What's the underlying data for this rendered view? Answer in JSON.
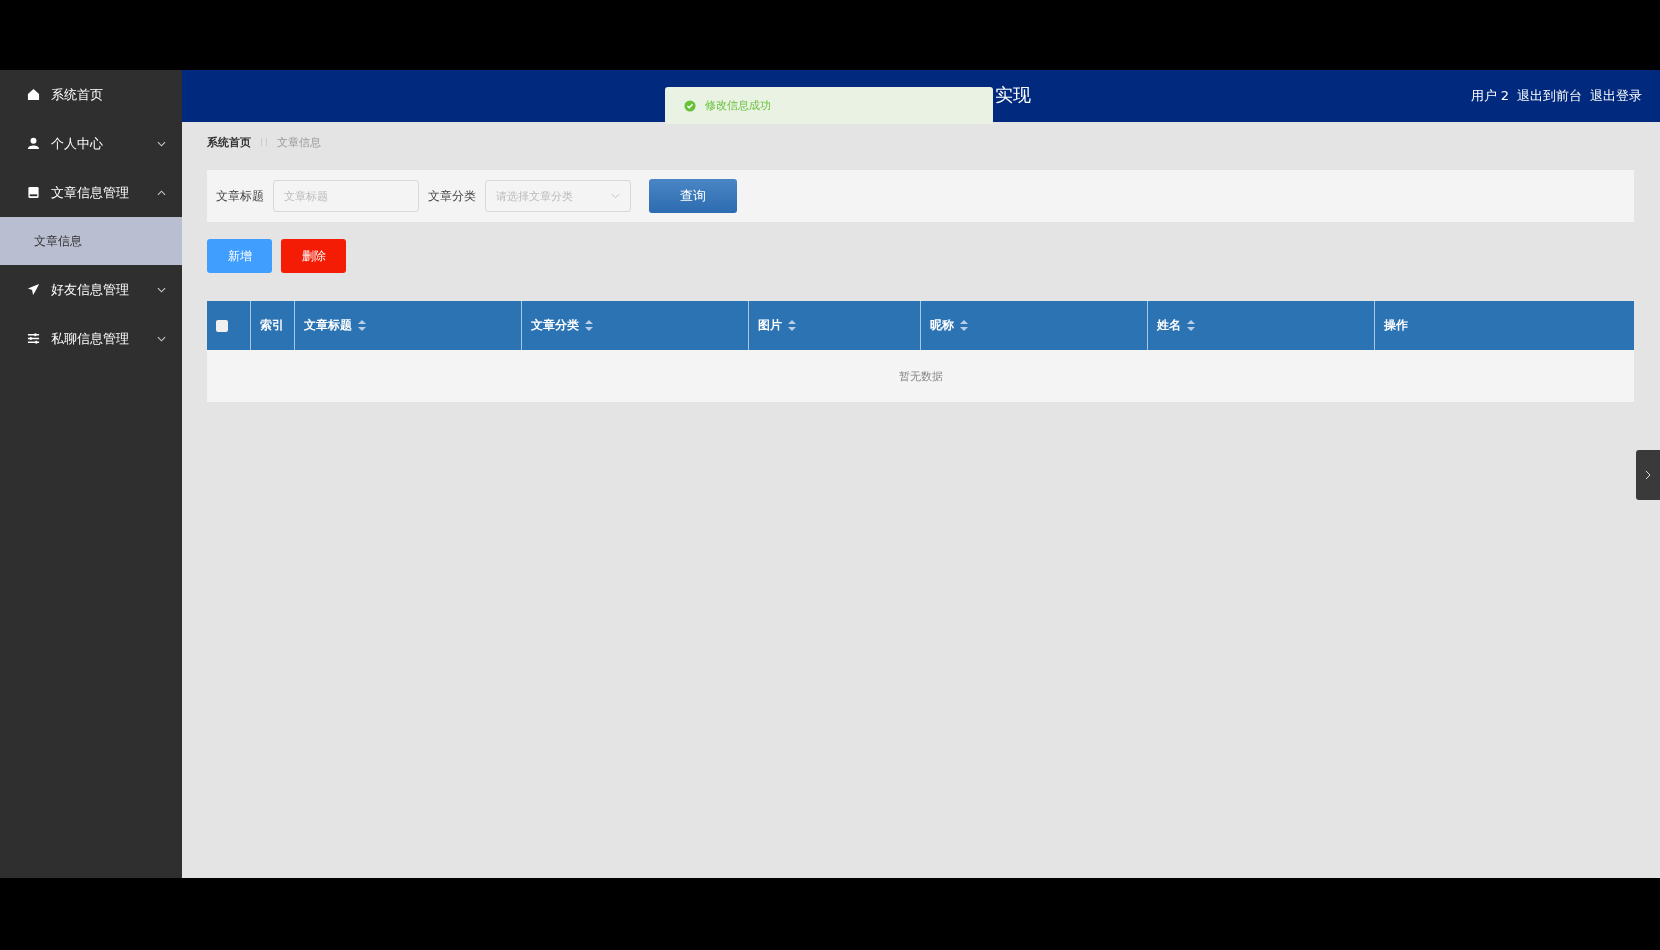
{
  "sidebar": {
    "items": [
      {
        "label": "系统首页",
        "kind": "home"
      },
      {
        "label": "个人中心",
        "kind": "user",
        "expanded": false
      },
      {
        "label": "文章信息管理",
        "kind": "document",
        "expanded": true,
        "children": [
          {
            "label": "文章信息",
            "selected": true
          }
        ]
      },
      {
        "label": "好友信息管理",
        "kind": "plane",
        "expanded": false
      },
      {
        "label": "私聊信息管理",
        "kind": "sliders",
        "expanded": false
      }
    ]
  },
  "header": {
    "title": "实现",
    "user": "用户 2",
    "links": [
      "退出到前台",
      "退出登录"
    ]
  },
  "toast": {
    "kind": "success",
    "message": "修改信息成功"
  },
  "breadcrumb": [
    "系统首页",
    "文章信息"
  ],
  "search": {
    "fields": [
      {
        "kind": "input",
        "label": "文章标题",
        "placeholder": "文章标题"
      },
      {
        "kind": "select",
        "label": "文章分类",
        "placeholder": "请选择文章分类"
      }
    ],
    "button": "查询"
  },
  "actions": [
    {
      "label": "新增",
      "kind": "primary"
    },
    {
      "label": "删除",
      "kind": "danger"
    }
  ],
  "table": {
    "select_all": {
      "checked": false
    },
    "columns": [
      {
        "label": "索引",
        "sortable": false
      },
      {
        "label": "文章标题",
        "sortable": true
      },
      {
        "label": "文章分类",
        "sortable": true
      },
      {
        "label": "图片",
        "sortable": true
      },
      {
        "label": "昵称",
        "sortable": true
      },
      {
        "label": "姓名",
        "sortable": true
      },
      {
        "label": "操作",
        "sortable": false
      }
    ],
    "empty_text": "暂无数据"
  }
}
